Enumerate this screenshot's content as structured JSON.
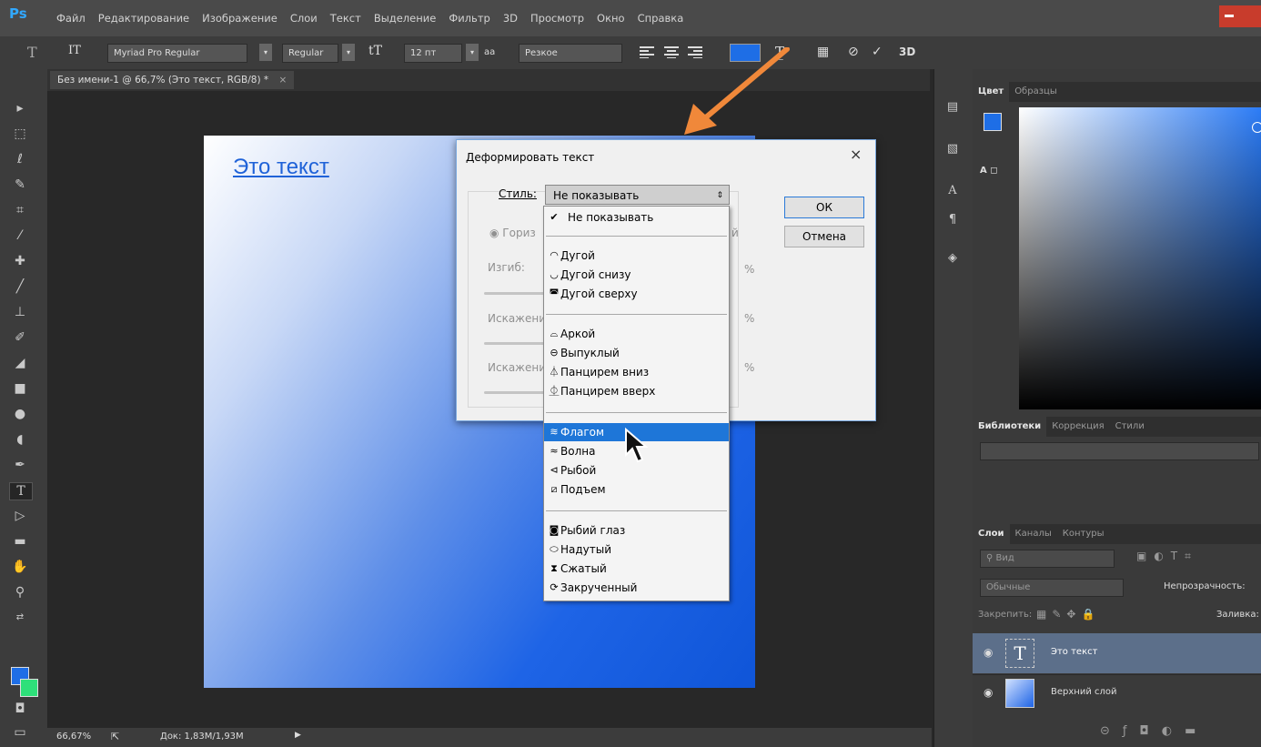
{
  "app": {
    "logo": "Ps"
  },
  "menubar": {
    "items": [
      "Файл",
      "Редактирование",
      "Изображение",
      "Слои",
      "Текст",
      "Выделение",
      "Фильтр",
      "3D",
      "Просмотр",
      "Окно",
      "Справка"
    ]
  },
  "options": {
    "font_family": "Myriad Pro Regular",
    "font_style": "Regular",
    "font_size": "12 пт",
    "aa_icon": "aa",
    "antialias": "Резкое",
    "threeD": "3D",
    "color": "#1e6ee6"
  },
  "document": {
    "tab_title": "Без имени-1 @ 66,7% (Это текст, RGB/8) *",
    "tab_close": "×",
    "canvas_text": "Это текст"
  },
  "status": {
    "zoom": "66,67%",
    "doc": "Док: 1,83M/1,93M"
  },
  "dialog": {
    "title": "Деформировать текст",
    "close": "×",
    "style_label": "Стиль:",
    "style_value": "Не показывать",
    "ok": "ОК",
    "cancel": "Отмена",
    "orient_label": "Гориз",
    "orient_trail": "й",
    "bend_label": "Изгиб:",
    "hdist_label": "Искажени",
    "vdist_label": "Искажени",
    "pct": "%"
  },
  "dropdown": {
    "none": "Не показывать",
    "groups": [
      [
        "Дугой",
        "Дугой снизу",
        "Дугой сверху"
      ],
      [
        "Аркой",
        "Выпуклый",
        "Панцирем вниз",
        "Панцирем вверх"
      ],
      [
        "Флагом",
        "Волна",
        "Рыбой",
        "Подъем"
      ],
      [
        "Рыбий глаз",
        "Надутый",
        "Сжатый",
        "Закрученный"
      ]
    ],
    "highlighted": "Флагом"
  },
  "panels": {
    "color_tabs": [
      "Цвет",
      "Образцы"
    ],
    "lib_tabs": [
      "Библиотеки",
      "Коррекция",
      "Стили"
    ],
    "layer_tabs": [
      "Слои",
      "Каналы",
      "Контуры"
    ],
    "filter_placeholder": "Вид",
    "blend_mode": "Обычные",
    "opacity_label": "Непрозрачность:",
    "lock_label": "Закрепить:",
    "fill_label": "Заливка:",
    "layers": [
      "Это текст",
      "Верхний слой"
    ],
    "text_thumb": "T"
  },
  "icons": {
    "text_tool": "T",
    "char_panel": "A",
    "para_panel": "¶"
  }
}
